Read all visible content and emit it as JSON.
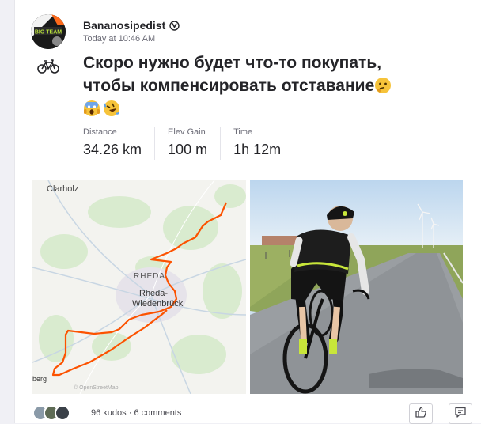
{
  "athlete": {
    "name": "Bananosipedist",
    "avatar_logo_text": "BIO TEAM",
    "verified_icon": "verified-badge-icon"
  },
  "activity": {
    "timestamp": "Today at 10:46 AM",
    "sport_icon": "bicycle-icon",
    "title_line1": "Скоро нужно будет что-то покупать,",
    "title_line2": "чтобы компенсировать отставание",
    "title_emojis": [
      "thinking-face-emoji",
      "screaming-face-emoji",
      "rolling-laughing-emoji"
    ]
  },
  "stats": [
    {
      "label": "Distance",
      "value": "34.26",
      "unit": " km"
    },
    {
      "label": "Elev Gain",
      "value": "100",
      "unit": " m"
    },
    {
      "label": "Time",
      "value": "1h 12m",
      "unit": ""
    }
  ],
  "map": {
    "labels": {
      "north": "Clarholz",
      "center1": "RHEDA",
      "city1": "Rheda-",
      "city2": "Wiedenbrück",
      "edge": "berg",
      "attribution": "© OpenStreetMap"
    },
    "route_color": "#fc5200"
  },
  "social": {
    "kudos_count": "96 kudos",
    "separator": "·",
    "comments": "6 comments"
  },
  "actions": {
    "kudos_icon": "thumbs-up-icon",
    "comment_icon": "comment-icon"
  }
}
